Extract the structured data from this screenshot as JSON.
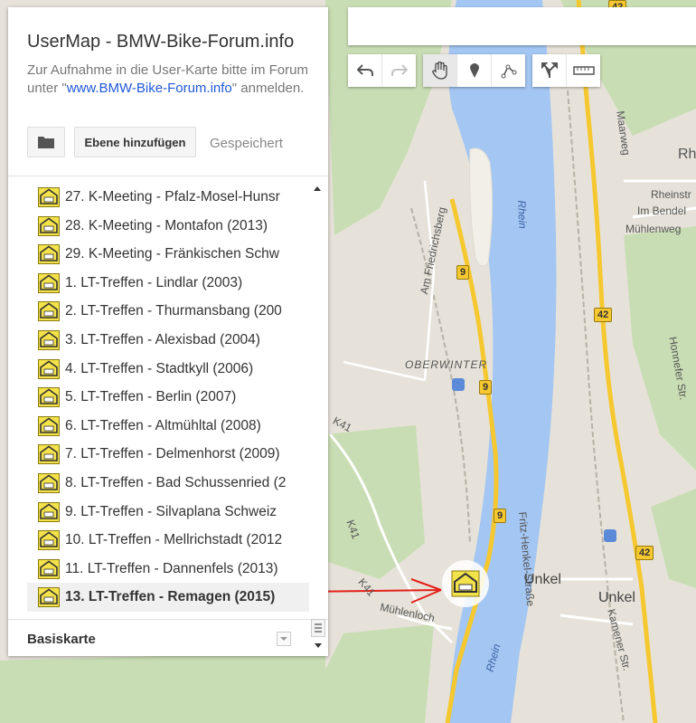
{
  "panel": {
    "title": "UserMap - BMW-Bike-Forum.info",
    "desc_before": "Zur Aufnahme in die User-Karte bitte im Forum unter \"",
    "desc_link": "www.BMW-Bike-Forum.info",
    "desc_after": "\" anmelden.",
    "add_layer_label": "Ebene hinzufügen",
    "saved_label": "Gespeichert",
    "basemap_label": "Basiskarte"
  },
  "layer_items": [
    {
      "label": "27. K-Meeting - Pfalz-Mosel-Hunsr"
    },
    {
      "label": "28. K-Meeting - Montafon (2013)"
    },
    {
      "label": "29. K-Meeting - Fränkischen Schw"
    },
    {
      "label": "1. LT-Treffen - Lindlar (2003)"
    },
    {
      "label": "2. LT-Treffen - Thurmansbang (200"
    },
    {
      "label": "3. LT-Treffen - Alexisbad (2004)"
    },
    {
      "label": "4. LT-Treffen - Stadtkyll (2006)"
    },
    {
      "label": "5. LT-Treffen - Berlin (2007)"
    },
    {
      "label": "6. LT-Treffen - Altmühltal (2008)"
    },
    {
      "label": "7. LT-Treffen - Delmenhorst (2009)"
    },
    {
      "label": "8. LT-Treffen - Bad Schussenried (2"
    },
    {
      "label": "9. LT-Treffen - Silvaplana Schweiz"
    },
    {
      "label": "10. LT-Treffen - Mellrichstadt (2012"
    },
    {
      "label": "11. LT-Treffen - Dannenfels (2013)"
    },
    {
      "label": "13. LT-Treffen - Remagen (2015)",
      "selected": true
    }
  ],
  "map_labels": {
    "rhein_top": "Rhein",
    "rhein_bottom": "Rhein",
    "oberwinter": "OBERWINTER",
    "am_friedrichsberg": "Am Friedrichsberg",
    "maarweg": "Maarweg",
    "rheinstr": "Rheinstr",
    "im_bendel": "Im Bendel",
    "muehlenweg": "Mühlenweg",
    "rh": "Rh",
    "honnefer_str": "Honnefer Str.",
    "k41_a": "K41",
    "k41_b": "K41",
    "k41_c": "K41",
    "muehlenloch": "Mühlenloch",
    "fritz_henkel": "Fritz-Henkel-Straße",
    "unkel_1": "Unkel",
    "unkel_2": "Unkel",
    "kamener": "Kamener Str.",
    "shield_42_top": "42",
    "shield_42_mid": "42",
    "shield_42_low": "42",
    "shield_9_a": "9",
    "shield_9_b": "9",
    "shield_9_c": "9"
  },
  "colors": {
    "river": "#a4c6f2",
    "road_major": "#f6c830",
    "forest": "#c5dcb0",
    "link": "#2159d8"
  }
}
